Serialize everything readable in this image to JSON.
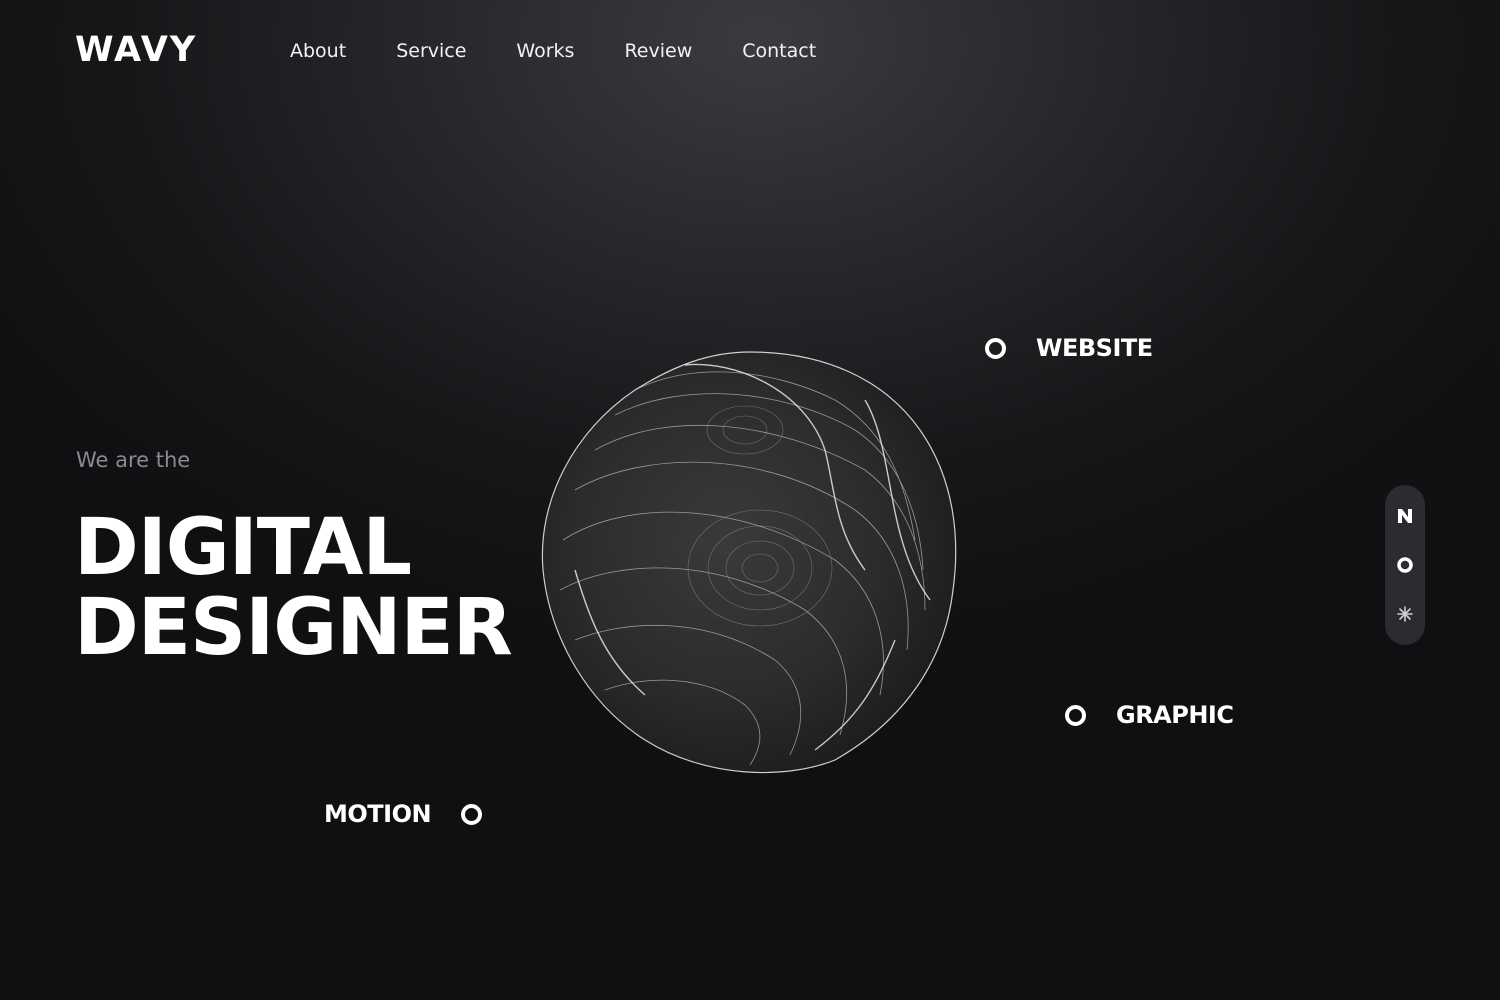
{
  "brand": {
    "logo": "WAVY"
  },
  "nav": {
    "items": [
      {
        "label": "About"
      },
      {
        "label": "Service"
      },
      {
        "label": "Works"
      },
      {
        "label": "Review"
      },
      {
        "label": "Contact"
      }
    ]
  },
  "hero": {
    "subtitle": "We are the",
    "headline_line1": "DIGITAL",
    "headline_line2": "DESIGNER"
  },
  "tags": {
    "website": "WEBSITE",
    "graphic": "GRAPHIC",
    "motion": "MOTION"
  },
  "side_panel": {
    "icons": [
      "brand-n-icon",
      "ring-icon",
      "sparkle-icon"
    ]
  },
  "colors": {
    "background": "#141517",
    "text": "#ffffff",
    "muted": "#8a8b8e",
    "panel": "#2b2c2f"
  }
}
